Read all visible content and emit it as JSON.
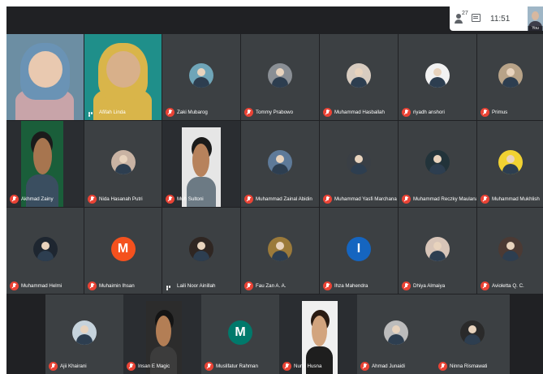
{
  "topbar": {
    "participants_count": "27",
    "clock": "11:51",
    "self_view_label": "You",
    "people_icon": "people-icon",
    "chat_icon": "chat-icon"
  },
  "colors": {
    "background": "#202124",
    "tile": "#3c4043",
    "mic_muted": "#ea4335",
    "speaking_outline": "#8ab4f8"
  },
  "participants": [
    {
      "name": "",
      "kind": "video",
      "muted": false,
      "speaking": true
    },
    {
      "name": "Afifah Linda",
      "kind": "video",
      "muted": false
    },
    {
      "name": "Zaki Mubarog",
      "kind": "avatar",
      "avatar_color": "#6fa5b8",
      "muted": true
    },
    {
      "name": "Tommy Prabowo",
      "kind": "avatar",
      "avatar_color": "#8a8f95",
      "muted": true
    },
    {
      "name": "Muhammad Hasballah",
      "kind": "avatar",
      "avatar_color": "#d8ccc0",
      "muted": true
    },
    {
      "name": "riyadh anshori",
      "kind": "avatar",
      "avatar_color": "#f2f2f2",
      "muted": true
    },
    {
      "name": "Primus",
      "kind": "avatar",
      "avatar_color": "#b8a388",
      "muted": true
    },
    {
      "name": "Akhmad Zainy",
      "kind": "video",
      "muted": true
    },
    {
      "name": "Nida Hasanah Putri",
      "kind": "avatar",
      "avatar_color": "#c9b3a3",
      "muted": true
    },
    {
      "name": "Muh Sultoni",
      "kind": "video",
      "muted": true
    },
    {
      "name": "Muhammad Zainal Abidin",
      "kind": "avatar",
      "avatar_color": "#5e7a99",
      "muted": true,
      "pinned": true
    },
    {
      "name": "Muhammad Yasfi Marchana",
      "kind": "avatar",
      "avatar_color": "#3a3f45",
      "muted": true
    },
    {
      "name": "Muhammad Reczky Maulana",
      "kind": "avatar",
      "avatar_color": "#22333a",
      "muted": true
    },
    {
      "name": "Muhammad Mukhlish",
      "kind": "avatar",
      "avatar_color": "#f1d232",
      "muted": true
    },
    {
      "name": "Muhammad Helmi",
      "kind": "avatar",
      "avatar_color": "#1e2630",
      "muted": true
    },
    {
      "name": "Muhaimin Ihsan",
      "kind": "letter",
      "letter": "M",
      "avatar_color": "#f4511e",
      "muted": true
    },
    {
      "name": "Laili Noor Ainillah",
      "kind": "avatar",
      "avatar_color": "#2f2622",
      "muted": false
    },
    {
      "name": "Fau Zan A. A.",
      "kind": "avatar",
      "avatar_color": "#9b7a3a",
      "muted": true
    },
    {
      "name": "Ihza Mahendra",
      "kind": "letter",
      "letter": "I",
      "avatar_color": "#1565c0",
      "muted": true
    },
    {
      "name": "Dhiya Almaiya",
      "kind": "avatar",
      "avatar_color": "#d8c5b8",
      "muted": true
    },
    {
      "name": "Avioletta Q. C.",
      "kind": "avatar",
      "avatar_color": "#4b3a34",
      "muted": true
    },
    {
      "name": "Ajii Khairani",
      "kind": "avatar",
      "avatar_color": "#c6d3dc",
      "muted": true
    },
    {
      "name": "Insan E Magic",
      "kind": "video",
      "muted": true
    },
    {
      "name": "Muslifatur Rahman",
      "kind": "letter",
      "letter": "M",
      "avatar_color": "#00796b",
      "muted": true
    },
    {
      "name": "Nurul Husna",
      "kind": "video",
      "muted": true
    },
    {
      "name": "Ahmad Junaidi",
      "kind": "avatar",
      "avatar_color": "#bcbcbc",
      "muted": true
    },
    {
      "name": "Ninna Rismawati",
      "kind": "avatar",
      "avatar_color": "#2a2a2a",
      "muted": true
    }
  ]
}
